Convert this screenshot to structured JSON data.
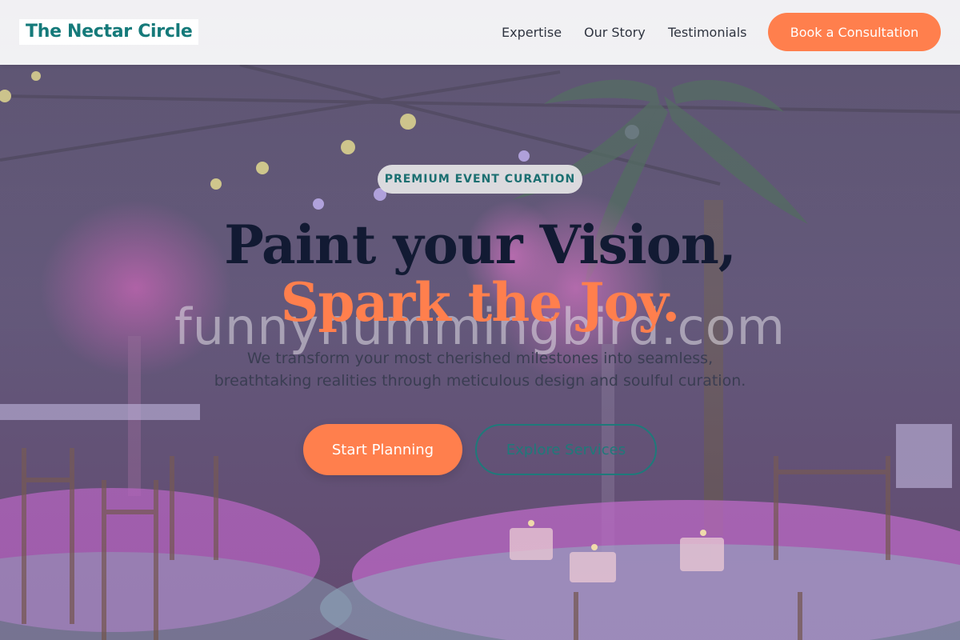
{
  "brand": {
    "name": "The Nectar Circle",
    "primary_color": "#157a7a",
    "accent_color": "#ff7f4d"
  },
  "nav": {
    "items": [
      "Expertise",
      "Our Story",
      "Testimonials"
    ],
    "cta_label": "Book a Consultation"
  },
  "hero": {
    "badge": "PREMIUM EVENT CURATION",
    "title_line1": "Paint your Vision,",
    "title_line2": "Spark the Joy.",
    "subtitle_line1": "We transform your most cherished milestones into seamless,",
    "subtitle_line2": "breathtaking realities through meticulous design and soulful curation.",
    "primary_button": "Start Planning",
    "secondary_button": "Explore Services",
    "background": "banquet-hall-photo"
  },
  "watermark": "funnyhummingbird.com"
}
